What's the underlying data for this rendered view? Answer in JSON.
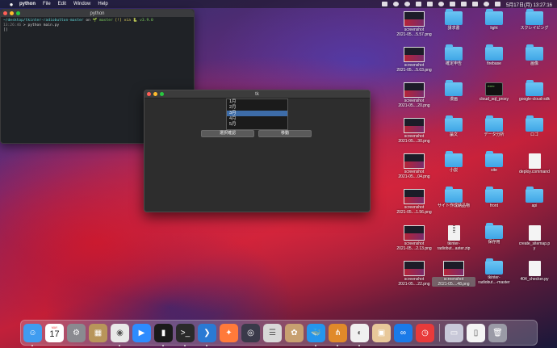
{
  "menubar": {
    "items": [
      "python",
      "File",
      "Edit",
      "Window",
      "Help"
    ],
    "clock": "5月17日(月)  13:27:16"
  },
  "terminal": {
    "title": "python",
    "line1_path": "~/desktop/tkinter-radiobutton-master",
    "line1_on": " on ",
    "line1_branch": "🌱 master",
    "line1_status": " [!] via ",
    "line1_py": "🐍 v3.9.0",
    "line2_time": "13:26:46",
    "line2_cmd": " > python main.py",
    "line3": "[]"
  },
  "tk": {
    "title": "tk",
    "list": [
      "1月",
      "2月",
      "3月",
      "4月",
      "5月"
    ],
    "selected_index": 2,
    "button_left": "選択確認",
    "button_right": "移動"
  },
  "desktop": {
    "col1": [
      {
        "type": "shot",
        "label": "screenshot\n2021-05....5.57.png"
      },
      {
        "type": "shot",
        "label": "screenshot\n2021-05....5.03.png"
      },
      {
        "type": "shot",
        "label": "screenshot\n2021-05....20.png"
      },
      {
        "type": "shot",
        "label": "screenshot\n2021-05....30.png"
      },
      {
        "type": "shot",
        "label": "screenshot\n2021-05....04.png"
      },
      {
        "type": "shot",
        "label": "screenshot\n2021-05....1.56.png"
      },
      {
        "type": "shot",
        "label": "screenshot\n2021-05....2.13.png"
      },
      {
        "type": "shot",
        "label": "screenshot\n2021-05....22.png"
      }
    ],
    "col2": [
      {
        "type": "folder",
        "label": "請求書"
      },
      {
        "type": "folder",
        "label": "確定申告"
      },
      {
        "type": "folder",
        "label": "漫画"
      },
      {
        "type": "folder",
        "label": "論文"
      },
      {
        "type": "folder",
        "label": "小説"
      },
      {
        "type": "folder",
        "label": "サイト作成納品物"
      },
      {
        "type": "zip",
        "label": "tkinter-\nradiobut...aster.zip"
      },
      {
        "type": "shot",
        "label": "screenshot\n2021-05....48.png",
        "selected": true
      }
    ],
    "col3": [
      {
        "type": "folder",
        "label": "light"
      },
      {
        "type": "folder",
        "label": "firebase"
      },
      {
        "type": "exec",
        "label": "cloud_sql_proxy"
      },
      {
        "type": "folder",
        "label": "データ分析"
      },
      {
        "type": "folder",
        "label": "site"
      },
      {
        "type": "folder",
        "label": "front"
      },
      {
        "type": "folder",
        "label": "保存用"
      },
      {
        "type": "folder",
        "label": "tkinter-\nradiobut...-master"
      }
    ],
    "col4": [
      {
        "type": "folder",
        "label": "スクレイピング"
      },
      {
        "type": "folder",
        "label": "画像"
      },
      {
        "type": "folder",
        "label": "google-cloud-sdk"
      },
      {
        "type": "folder",
        "label": "ロゴ"
      },
      {
        "type": "doc",
        "label": "deploy.command"
      },
      {
        "type": "folder",
        "label": "api"
      },
      {
        "type": "doc",
        "label": "create_sitemap.p\ny"
      },
      {
        "type": "doc",
        "label": "404_checker.py"
      }
    ]
  },
  "dock": {
    "calendar_day": "17",
    "calendar_month": "MAY",
    "apps": [
      {
        "name": "finder-icon",
        "color": "#3f9cf0",
        "glyph": "☺"
      },
      {
        "name": "calendar-icon",
        "color": "#ffffff",
        "glyph": ""
      },
      {
        "name": "system-preferences-icon",
        "color": "#8a8a90",
        "glyph": "⚙"
      },
      {
        "name": "archive-icon",
        "color": "#b8955a",
        "glyph": "▦"
      },
      {
        "name": "chrome-icon",
        "color": "#e8e8e8",
        "glyph": "◉"
      },
      {
        "name": "zoom-icon",
        "color": "#2d8cff",
        "glyph": "▶"
      },
      {
        "name": "activity-monitor-icon",
        "color": "#1a1a1a",
        "glyph": "▮"
      },
      {
        "name": "terminal-icon",
        "color": "#2a2a2a",
        "glyph": ">_"
      },
      {
        "name": "vscode-icon",
        "color": "#2a7ad4",
        "glyph": "❯"
      },
      {
        "name": "safari-icon",
        "color": "#ff7a3a",
        "glyph": "✦"
      },
      {
        "name": "quicktime-icon",
        "color": "#3a3a4a",
        "glyph": "◎"
      },
      {
        "name": "sequel-icon",
        "color": "#d8d8d8",
        "glyph": "☰"
      },
      {
        "name": "package-icon",
        "color": "#c8a070",
        "glyph": "✿"
      },
      {
        "name": "docker-icon",
        "color": "#2496ed",
        "glyph": "🐳"
      },
      {
        "name": "sourcetree-icon",
        "color": "#e08a2a",
        "glyph": "⋔"
      },
      {
        "name": "tableplus-icon",
        "color": "#f0f0f0",
        "glyph": "◐"
      },
      {
        "name": "preview-icon",
        "color": "#e8c89a",
        "glyph": "▣"
      },
      {
        "name": "infinity-icon",
        "color": "#1a7ae8",
        "glyph": "∞"
      },
      {
        "name": "clock-icon",
        "color": "#e83a3a",
        "glyph": "◷"
      }
    ],
    "right": [
      {
        "name": "screenshot-stack-icon",
        "color": "#c8c8d8",
        "glyph": "▭"
      },
      {
        "name": "document-stack-icon",
        "color": "#f4f4f4",
        "glyph": "▯"
      },
      {
        "name": "trash-icon",
        "color": "#9a9aa6",
        "glyph": "🗑"
      }
    ]
  }
}
